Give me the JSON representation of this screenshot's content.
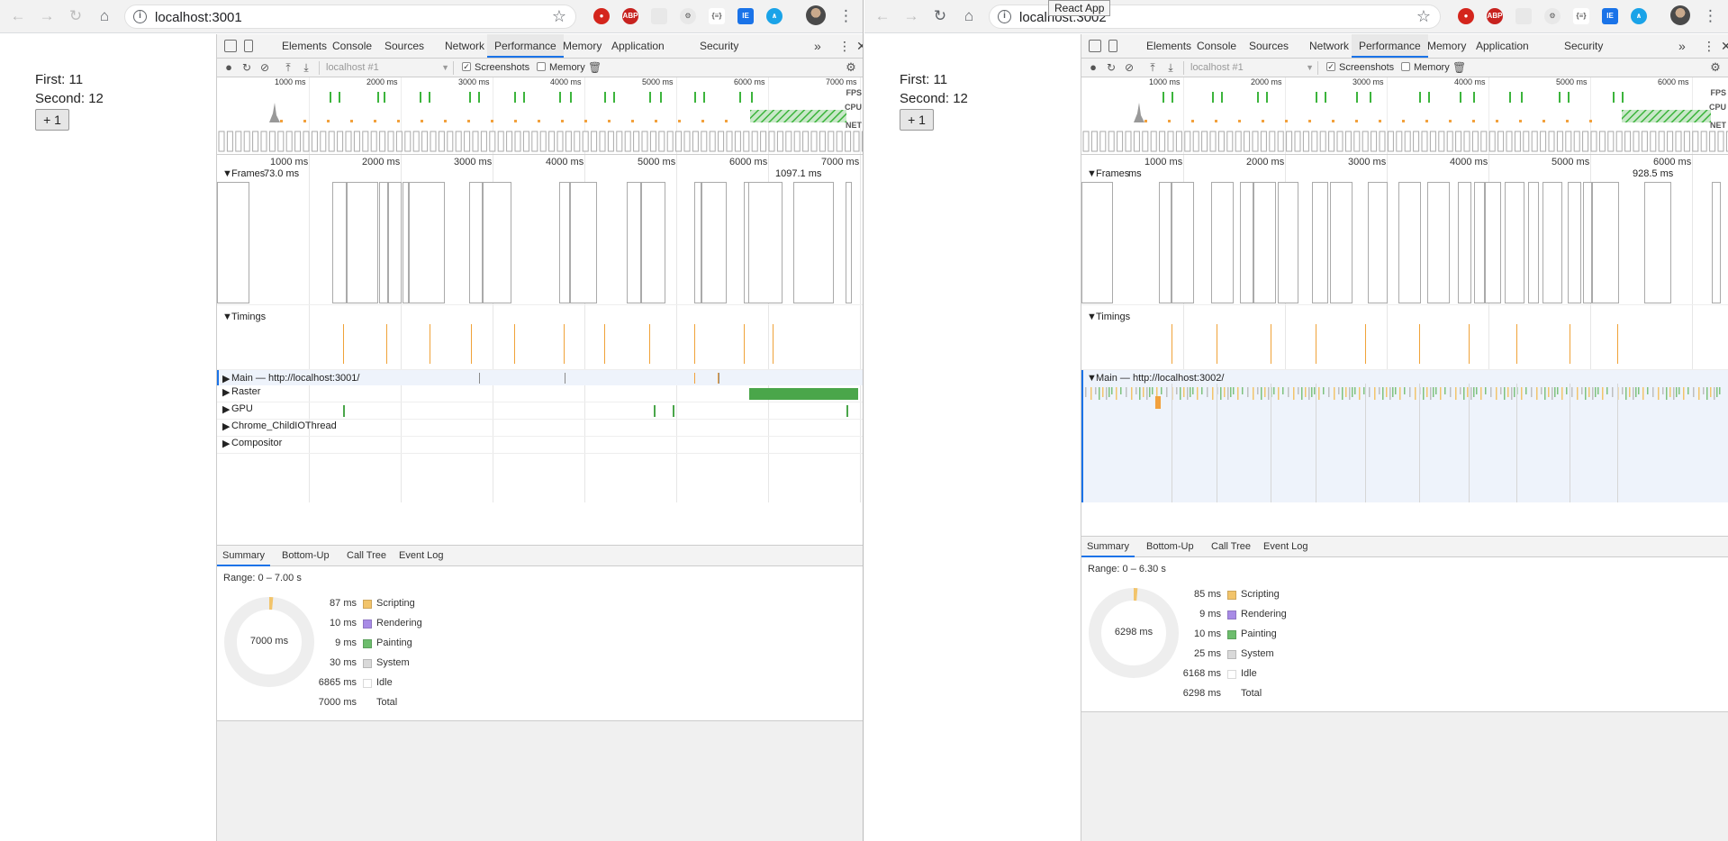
{
  "tooltip": "React App",
  "windows": [
    {
      "url": "localhost:3001",
      "app": {
        "first": "First: 11",
        "second": "Second: 12",
        "button": "+ 1"
      },
      "devtools": {
        "tabs": [
          "Elements",
          "Console",
          "Sources",
          "Network",
          "Performance",
          "Memory",
          "Application",
          "Security"
        ],
        "active_tab": "Performance",
        "more": "»",
        "target": "localhost #1",
        "screenshots_label": "Screenshots",
        "memory_label": "Memory",
        "overview_ticks": [
          "1000 ms",
          "2000 ms",
          "3000 ms",
          "4000 ms",
          "5000 ms",
          "6000 ms",
          "7000 ms"
        ],
        "overview_labels": [
          "FPS",
          "CPU",
          "NET"
        ],
        "timeline_ticks": [
          "1000 ms",
          "2000 ms",
          "3000 ms",
          "4000 ms",
          "5000 ms",
          "6000 ms",
          "7000 ms"
        ],
        "frames": {
          "label": "Frames",
          "first": "73.0 ms",
          "last": "1097.1 ms"
        },
        "timings_label": "Timings",
        "main_label": "Main — http://localhost:3001/",
        "tracks": [
          "Raster",
          "GPU",
          "Chrome_ChildIOThread",
          "Compositor"
        ],
        "summary": {
          "tabs": [
            "Summary",
            "Bottom-Up",
            "Call Tree",
            "Event Log"
          ],
          "range": "Range: 0 – 7.00 s",
          "center": "7000 ms",
          "rows": [
            {
              "ms": "87 ms",
              "name": "Scripting",
              "color": "#f2c46b"
            },
            {
              "ms": "10 ms",
              "name": "Rendering",
              "color": "#a88be6"
            },
            {
              "ms": "9 ms",
              "name": "Painting",
              "color": "#6dbd6d"
            },
            {
              "ms": "30 ms",
              "name": "System",
              "color": "#d9d9d9"
            },
            {
              "ms": "6865 ms",
              "name": "Idle",
              "color": "#ffffff"
            },
            {
              "ms": "7000 ms",
              "name": "Total",
              "color": ""
            }
          ]
        }
      }
    },
    {
      "url": "localhost:3002",
      "app": {
        "first": "First: 11",
        "second": "Second: 12",
        "button": "+ 1"
      },
      "devtools": {
        "tabs": [
          "Elements",
          "Console",
          "Sources",
          "Network",
          "Performance",
          "Memory",
          "Application",
          "Security"
        ],
        "active_tab": "Performance",
        "more": "»",
        "target": "localhost #1",
        "screenshots_label": "Screenshots",
        "memory_label": "Memory",
        "overview_ticks": [
          "1000 ms",
          "2000 ms",
          "3000 ms",
          "4000 ms",
          "5000 ms",
          "6000 ms"
        ],
        "overview_labels": [
          "FPS",
          "CPU",
          "NET"
        ],
        "timeline_ticks": [
          "1000 ms",
          "2000 ms",
          "3000 ms",
          "4000 ms",
          "5000 ms",
          "6000 ms"
        ],
        "frames": {
          "label": "Frames",
          "first": "ms",
          "last": "928.5 ms"
        },
        "timings_label": "Timings",
        "main_label": "Main — http://localhost:3002/",
        "tracks": [],
        "summary": {
          "tabs": [
            "Summary",
            "Bottom-Up",
            "Call Tree",
            "Event Log"
          ],
          "range": "Range: 0 – 6.30 s",
          "center": "6298 ms",
          "rows": [
            {
              "ms": "85 ms",
              "name": "Scripting",
              "color": "#f2c46b"
            },
            {
              "ms": "9 ms",
              "name": "Rendering",
              "color": "#a88be6"
            },
            {
              "ms": "10 ms",
              "name": "Painting",
              "color": "#6dbd6d"
            },
            {
              "ms": "25 ms",
              "name": "System",
              "color": "#d9d9d9"
            },
            {
              "ms": "6168 ms",
              "name": "Idle",
              "color": "#ffffff"
            },
            {
              "ms": "6298 ms",
              "name": "Total",
              "color": ""
            }
          ]
        }
      }
    }
  ]
}
